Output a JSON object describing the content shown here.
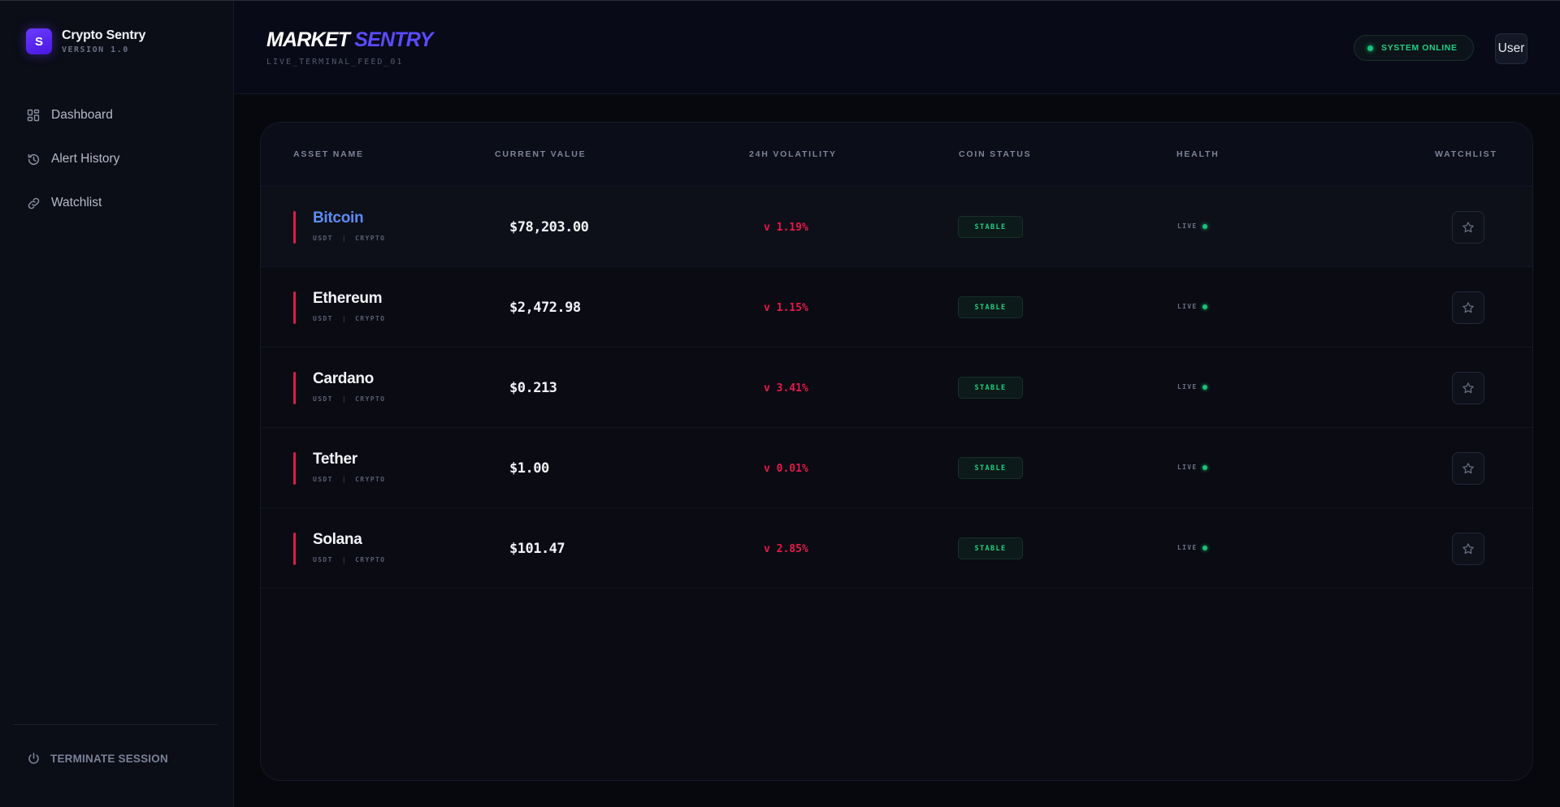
{
  "brand": {
    "logo_letter": "S",
    "name": "Crypto Sentry",
    "version": "VERSION 1.0"
  },
  "sidebar": {
    "items": [
      {
        "label": "Dashboard",
        "icon": "grid-icon"
      },
      {
        "label": "Alert History",
        "icon": "history-icon"
      },
      {
        "label": "Watchlist",
        "icon": "link-icon"
      }
    ],
    "terminate_label": "TERMINATE SESSION"
  },
  "header": {
    "title_part1": "MARKET",
    "title_part2": "SENTRY",
    "subtitle": "LIVE_TERMINAL_FEED_01",
    "status": "SYSTEM ONLINE",
    "user_label": "User"
  },
  "table": {
    "columns": {
      "asset": "ASSET NAME",
      "value": "CURRENT VALUE",
      "volatility": "24H VOLATILITY",
      "status": "COIN STATUS",
      "health": "HEALTH",
      "watchlist": "WATCHLIST"
    },
    "rows": [
      {
        "name": "Bitcoin",
        "pair": "USDT",
        "sep": "|",
        "type": "CRYPTO",
        "price": "$78,203.00",
        "volatility": "v 1.19%",
        "status": "STABLE",
        "health": "LIVE"
      },
      {
        "name": "Ethereum",
        "pair": "USDT",
        "sep": "|",
        "type": "CRYPTO",
        "price": "$2,472.98",
        "volatility": "v 1.15%",
        "status": "STABLE",
        "health": "LIVE"
      },
      {
        "name": "Cardano",
        "pair": "USDT",
        "sep": "|",
        "type": "CRYPTO",
        "price": "$0.213",
        "volatility": "v 3.41%",
        "status": "STABLE",
        "health": "LIVE"
      },
      {
        "name": "Tether",
        "pair": "USDT",
        "sep": "|",
        "type": "CRYPTO",
        "price": "$1.00",
        "volatility": "v 0.01%",
        "status": "STABLE",
        "health": "LIVE"
      },
      {
        "name": "Solana",
        "pair": "USDT",
        "sep": "|",
        "type": "CRYPTO",
        "price": "$101.47",
        "volatility": "v 2.85%",
        "status": "STABLE",
        "health": "LIVE"
      }
    ]
  },
  "colors": {
    "accent": "#5a4bff",
    "negative": "#e8184a",
    "positive": "#1fcf84",
    "link": "#5b8cf0"
  }
}
